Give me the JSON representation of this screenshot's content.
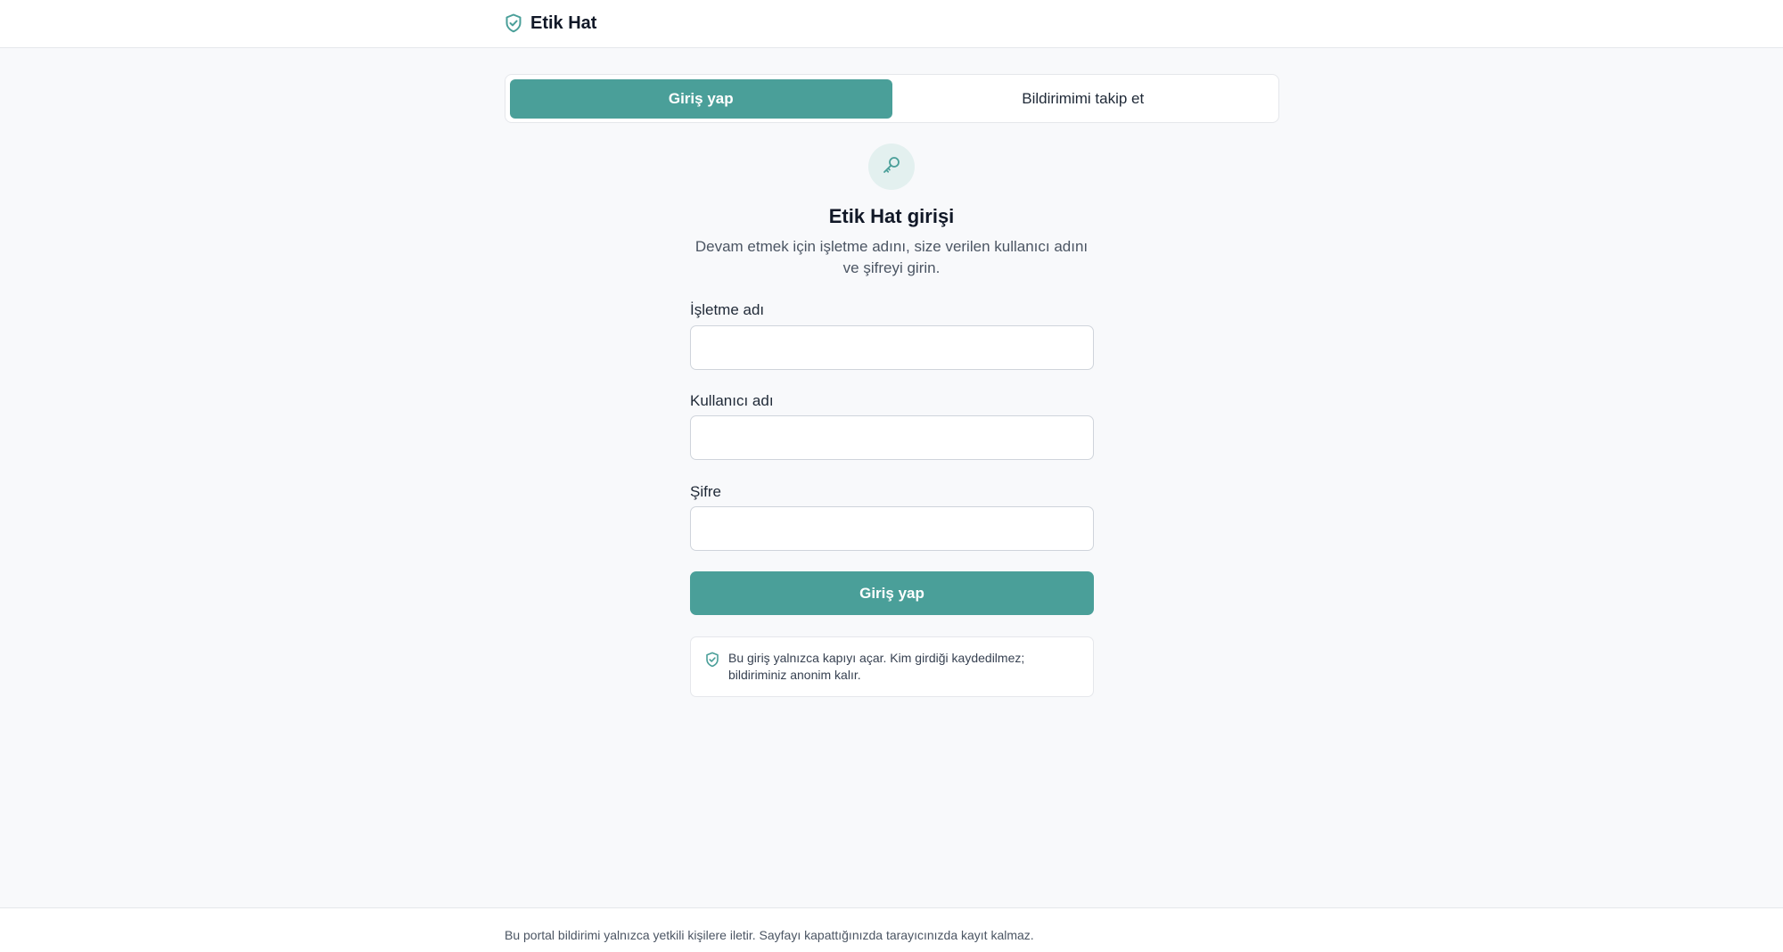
{
  "header": {
    "brand_icon": "shield-check-icon",
    "brand_name": "Etik Hat"
  },
  "tabs": [
    {
      "label": "Giriş yap",
      "active": true
    },
    {
      "label": "Bildirimimi takip et",
      "active": false
    }
  ],
  "login": {
    "icon": "key-icon",
    "title": "Etik Hat girişi",
    "subtitle": "Devam etmek için işletme adını, size verilen kullanıcı adını ve şifreyi girin.",
    "fields": [
      {
        "label": "İşletme adı",
        "value": "",
        "placeholder": ""
      },
      {
        "label": "Kullanıcı adı",
        "value": "",
        "placeholder": ""
      },
      {
        "label": "Şifre",
        "value": "",
        "placeholder": ""
      }
    ],
    "submit_label": "Giriş yap",
    "notice_icon": "shield-check-icon",
    "notice_text": "Bu giriş yalnızca kapıyı açar. Kim girdiği kaydedilmez; bildiriminiz anonim kalır."
  },
  "footer": {
    "text": "Bu portal bildirimi yalnızca yetkili kişilere iletir. Sayfayı kapattığınızda tarayıcınızda kayıt kalmaz."
  },
  "colors": {
    "accent": "#4a9f99",
    "accent_soft": "#e3f0ef",
    "background": "#f8f9fb"
  }
}
